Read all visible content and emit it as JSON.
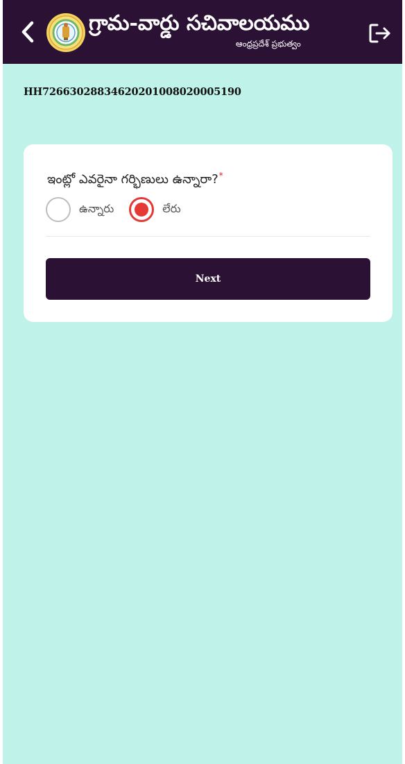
{
  "header": {
    "title": "గ్రామ-వార్డు సచివాలయము",
    "subtitle": "ఆంధ్రప్రదేశ్ ప్రభుత్వం",
    "back_icon": "chevron-left-icon",
    "emblem_icon": "ap-government-emblem-icon",
    "logout_icon": "logout-icon"
  },
  "household": {
    "id": "HH72663028834620201008020005190"
  },
  "form": {
    "question": "ఇంట్లో ఎవరైనా గర్భిణులు ఉన్నారా?",
    "required_marker": "*",
    "options": [
      {
        "label": "ఉన్నారు",
        "selected": false
      },
      {
        "label": "లేరు",
        "selected": true
      }
    ],
    "next_label": "Next"
  },
  "colors": {
    "header_bg": "#2b1134",
    "page_bg": "#bff2e9",
    "accent_red": "#e53935",
    "button_bg": "#2b1134"
  }
}
